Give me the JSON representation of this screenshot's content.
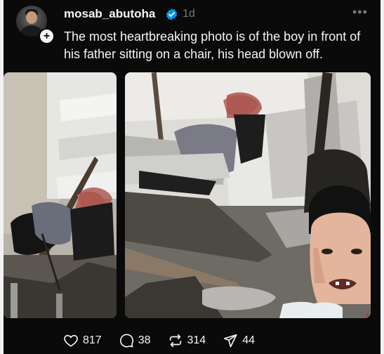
{
  "post": {
    "author": {
      "username": "mosab_abutoha",
      "verified_icon": "verified-badge-icon",
      "time_ago": "1d",
      "follow_icon": "plus-icon"
    },
    "more_icon": "ellipsis-icon",
    "text": "The most heartbreaking photo is of the boy in front of his father sitting on a chair, his head blown off.",
    "media": [
      {
        "kind": "photo"
      },
      {
        "kind": "photo"
      }
    ],
    "actions": {
      "likes": "817",
      "replies": "38",
      "reposts": "314",
      "shares": "44"
    }
  },
  "colors": {
    "background": "#0a0a0a",
    "text": "#f3f5f7",
    "secondary_text": "#777777",
    "verified": "#0095f6"
  }
}
